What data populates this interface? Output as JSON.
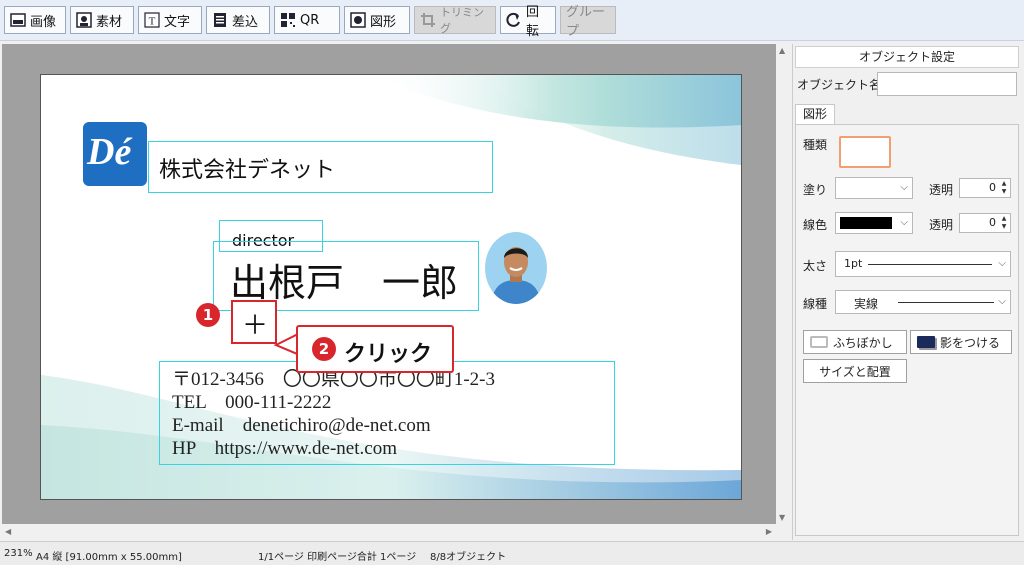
{
  "toolbar": {
    "image": "画像",
    "material": "素材",
    "text": "文字",
    "merge": "差込",
    "qr": "QR",
    "shape": "図形",
    "trim": "トリミング",
    "rotate": "回転",
    "group": "グループ"
  },
  "card": {
    "logo_text": "Dé",
    "company": "株式会社デネット",
    "title": "director",
    "name": "出根戸　一郎",
    "crosshair": "＋",
    "address_line1": "〒012-3456　〇〇県〇〇市〇〇町1-2-3",
    "tel": "TEL　000-111-2222",
    "email": "E-mail　denetichiro@de-net.com",
    "hp": "HP　https://www.de-net.com"
  },
  "annotation": {
    "step1": "1",
    "step2": "2",
    "click": "クリック"
  },
  "panel": {
    "title": "オブジェクト設定",
    "object_name_label": "オブジェクト名",
    "object_name_value": "",
    "tab_shape": "図形",
    "kind_label": "種類",
    "fill_label": "塗り",
    "fill_value": "",
    "transparency_label": "透明",
    "fill_transparency": "0",
    "line_color_label": "線色",
    "line_transparency": "0",
    "thickness_label": "太さ",
    "thickness_value": "1pt",
    "line_type_label": "線種",
    "line_type_value": "実線",
    "blur_button": "ふちぼかし",
    "shadow_button": "影をつける",
    "size_button": "サイズと配置"
  },
  "status": {
    "zoom": "231%",
    "paper": "A4 縦 [91.00mm x 55.00mm]",
    "pages": "1/1ページ 印刷ページ合計 1ページ",
    "objects": "8/8オブジェクト"
  },
  "colors": {
    "accent_red": "#d9262d",
    "selection_cyan": "#38d3e0",
    "logo_blue": "#1e6fc2",
    "kind_swatch_border": "#f0a070",
    "line_color": "#000000"
  }
}
